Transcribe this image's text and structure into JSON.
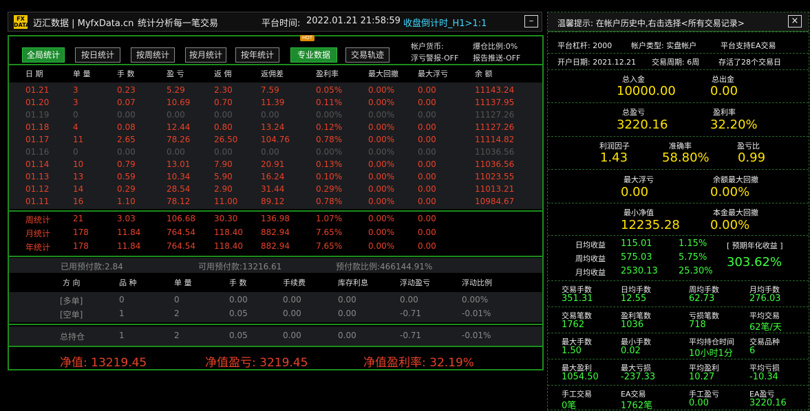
{
  "header": {
    "logo_top": "FX",
    "logo_bottom": "DATA",
    "brand": "迈汇数据 | MyfxData.cn",
    "subtitle": "统计分析每一笔交易",
    "server_time_label": "平台时间:",
    "server_time": "2022.01.21 21:58:59",
    "countdown": "收盘倒计时_H1>1:1",
    "minimize": "–"
  },
  "tabs": [
    {
      "label": "全局统计",
      "active": true
    },
    {
      "label": "按日统计"
    },
    {
      "label": "按周统计"
    },
    {
      "label": "按月统计"
    },
    {
      "label": "按年统计"
    },
    {
      "label": "专业数据",
      "active": true,
      "badge": "HOT"
    },
    {
      "label": "交易轨迹"
    }
  ],
  "account_info": {
    "currency": "帐户货币:",
    "float_alert": "浮亏警报-OFF",
    "blast_ratio": "爆仓比例:0%",
    "report_push": "报告推送-OFF"
  },
  "daily_table": {
    "columns": [
      "日 期",
      "单 量",
      "手 数",
      "盈 亏",
      "返 佣",
      "返佣差",
      "盈利率",
      "最大回撤",
      "最大浮亏",
      "余 额"
    ],
    "rows": [
      [
        "01.21",
        "3",
        "0.23",
        "5.29",
        "2.30",
        "7.59",
        "0.05%",
        "0.00%",
        "0.00",
        "11143.24"
      ],
      [
        "01.20",
        "3",
        "0.07",
        "10.69",
        "0.70",
        "11.39",
        "0.11%",
        "0.00%",
        "0.00",
        "11137.95"
      ],
      [
        "01.19",
        "0",
        "0.00",
        "0.00",
        "0.00",
        "0.00",
        "0.00%",
        "0.00%",
        "0.00",
        "11127.26"
      ],
      [
        "01.18",
        "4",
        "0.08",
        "12.44",
        "0.80",
        "13.24",
        "0.12%",
        "0.00%",
        "0.00",
        "11127.26"
      ],
      [
        "01.17",
        "11",
        "2.65",
        "78.26",
        "26.50",
        "104.76",
        "0.78%",
        "0.00%",
        "0.00",
        "11114.82"
      ],
      [
        "01.16",
        "0",
        "0.00",
        "0.00",
        "0.00",
        "0.00",
        "0.00%",
        "0.00%",
        "0.00",
        "11036.56"
      ],
      [
        "01.14",
        "10",
        "0.79",
        "13.01",
        "7.90",
        "20.91",
        "0.13%",
        "0.00%",
        "0.00",
        "11036.56"
      ],
      [
        "01.13",
        "13",
        "0.59",
        "10.34",
        "5.90",
        "16.24",
        "0.10%",
        "0.00%",
        "0.00",
        "11023.55"
      ],
      [
        "01.12",
        "14",
        "0.29",
        "28.54",
        "2.90",
        "31.44",
        "0.29%",
        "0.00%",
        "0.00",
        "11013.21"
      ],
      [
        "01.11",
        "16",
        "1.10",
        "78.12",
        "11.00",
        "89.12",
        "0.78%",
        "0.00%",
        "0.00",
        "10984.67"
      ]
    ]
  },
  "summary_rows": [
    [
      "周统计",
      "21",
      "3.03",
      "106.68",
      "30.30",
      "136.98",
      "1.07%",
      "0.00%",
      "0.00"
    ],
    [
      "月统计",
      "178",
      "11.84",
      "764.54",
      "118.40",
      "882.94",
      "7.65%",
      "0.00%",
      "0.00"
    ],
    [
      "年统计",
      "178",
      "11.84",
      "764.54",
      "118.40",
      "882.94",
      "7.65%",
      "0.00%",
      "0.00"
    ]
  ],
  "margin": {
    "used": "已用预付款:2.84",
    "free": "可用预付款:13216.61",
    "level": "预付款比例:466144.91%"
  },
  "positions": {
    "columns": [
      "方 向",
      "品 种",
      "单 量",
      "手 数",
      "手续费",
      "库存利息",
      "浮动盈亏",
      "浮动比例"
    ],
    "rows": [
      [
        "[多单]",
        "0",
        "0",
        "0.00",
        "0.00",
        "0.00",
        "0.00",
        "0.00%"
      ],
      [
        "[空单]",
        "1",
        "2",
        "0.05",
        "0.00",
        "0.00",
        "-0.71",
        "-0.01%"
      ]
    ],
    "total": [
      "总持仓",
      "1",
      "2",
      "0.05",
      "0.00",
      "0.00",
      "-0.71",
      "-0.01%"
    ]
  },
  "net": {
    "equity": "净值: 13219.45",
    "equity_pl": "净值盈亏: 3219.45",
    "equity_rate": "净值盈利率: 32.19%"
  },
  "right": {
    "tip": "温馨提示: 在帐户历史中,右击选择<所有交易记录>",
    "close": "×",
    "leverage": "平台杠杆: 2000",
    "acct_type": "帐户类型: 实盘帐户",
    "ea": "平台支持EA交易",
    "open_date": "开户日期: 2021.12.21",
    "period": "交易周期: 6周",
    "alive": "存活了28个交易日",
    "deposit_label": "总入金",
    "deposit": "10000.00",
    "withdraw_label": "总出金",
    "withdraw": "0.00",
    "profit_label": "总盈亏",
    "profit": "3220.16",
    "profit_rate_label": "盈利率",
    "profit_rate": "32.20%",
    "pf_label": "利润因子",
    "pf": "1.43",
    "acc_label": "准确率",
    "acc": "58.80%",
    "ratio_label": "盈亏比",
    "ratio": "0.99",
    "maxfl_label": "最大浮亏",
    "maxfl": "0.00",
    "baldd_label": "余额最大回撤",
    "baldd": "0.00%",
    "mineq_label": "最小净值",
    "mineq": "12235.28",
    "capdd_label": "本金最大回撤",
    "capdd": "0.00%",
    "avg": [
      {
        "label": "日均收益",
        "v": "115.01",
        "p": "1.15%"
      },
      {
        "label": "周均收益",
        "v": "575.03",
        "p": "5.75%"
      },
      {
        "label": "月均收益",
        "v": "2530.13",
        "p": "25.30%"
      }
    ],
    "annual_label": "[ 预期年化收益 ]",
    "annual": "303.62%",
    "grid": [
      [
        {
          "l": "交易手数",
          "v": "351.31"
        },
        {
          "l": "日均手数",
          "v": "12.55"
        },
        {
          "l": "周均手数",
          "v": "62.73"
        },
        {
          "l": "月均手数",
          "v": "276.03"
        }
      ],
      [
        {
          "l": "交易笔数",
          "v": "1762"
        },
        {
          "l": "盈利笔数",
          "v": "1036"
        },
        {
          "l": "亏损笔数",
          "v": "718"
        },
        {
          "l": "平均交易",
          "v": "62笔/天"
        }
      ],
      [
        {
          "l": "最大手数",
          "v": "1.50"
        },
        {
          "l": "最小手数",
          "v": "0.02"
        },
        {
          "l": "平均持仓时间",
          "v": "10小时1分"
        },
        {
          "l": "交易品种",
          "v": "6"
        }
      ],
      [
        {
          "l": "最大盈利",
          "v": "1054.50"
        },
        {
          "l": "最大亏损",
          "v": "-237.33"
        },
        {
          "l": "平均盈利",
          "v": "10.27"
        },
        {
          "l": "平均亏损",
          "v": "-10.34"
        }
      ],
      [
        {
          "l": "手工交易",
          "v": "0笔"
        },
        {
          "l": "EA交易",
          "v": "1762笔"
        },
        {
          "l": "手工盈亏",
          "v": "0.00"
        },
        {
          "l": "EA盈亏",
          "v": "3220.16"
        }
      ]
    ]
  },
  "colors": {
    "accent_green": "#1d8d1d",
    "loss_red": "#e8422a",
    "value_yellow": "#ffe500",
    "value_green": "#3fff3f",
    "countdown": "#3fd8ff"
  }
}
